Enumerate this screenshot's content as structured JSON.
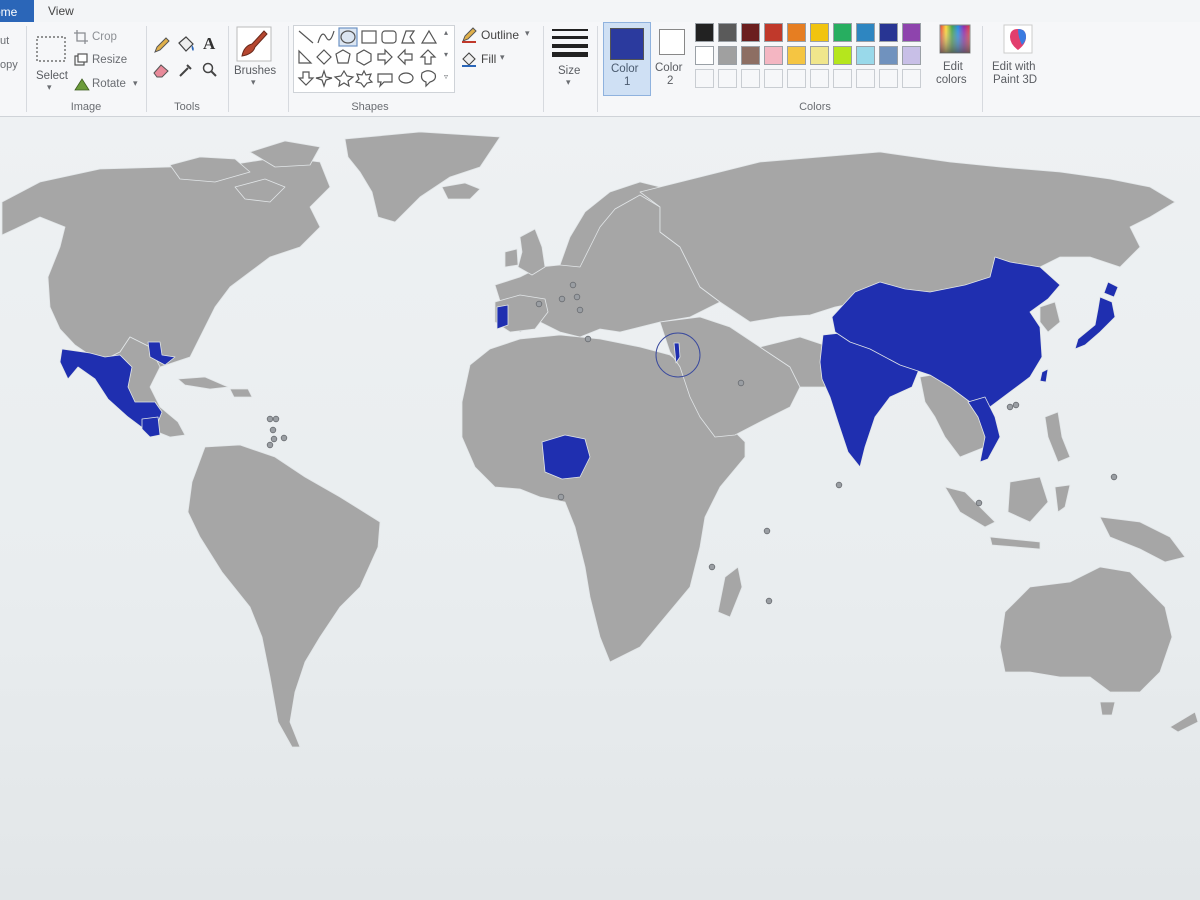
{
  "menu": {
    "home_tab": "ome",
    "view_tab": "View"
  },
  "clipboard": {
    "cut_label": "ut",
    "copy_label": "opy"
  },
  "image_group": {
    "label": "Image",
    "select_label": "Select",
    "crop_label": "Crop",
    "resize_label": "Resize",
    "rotate_label": "Rotate"
  },
  "tools_group": {
    "label": "Tools"
  },
  "brushes_label": "Brushes",
  "shapes_group": {
    "label": "Shapes",
    "outline_label": "Outline",
    "fill_label": "Fill"
  },
  "size_label": "Size",
  "colors_group": {
    "label": "Colors",
    "color1_line1": "Color",
    "color1_line2": "1",
    "color2_line1": "Color",
    "color2_line2": "2",
    "color1_value": "#2b3a9e",
    "color2_value": "#ffffff",
    "edit_colors_line1": "Edit",
    "edit_colors_line2": "colors",
    "paint3d_line1": "Edit with",
    "paint3d_line2": "Paint 3D",
    "palette_row1": [
      "#222222",
      "#5a5a5a",
      "#6b1e1e",
      "#c0392b",
      "#e67e22",
      "#f1c40f",
      "#27ae60",
      "#2e86c1",
      "#283593",
      "#8e44ad"
    ],
    "palette_row2": [
      "#ffffff",
      "#a0a0a0",
      "#8d6e63",
      "#f4b6c2",
      "#f5c542",
      "#f0e68c",
      "#b5e61d",
      "#99d9ea",
      "#7092be",
      "#c8bfe7"
    ]
  },
  "map": {
    "land_color": "#a6a6a6",
    "highlight_color": "#1f2fb0",
    "highlighted_countries": [
      "Mexico",
      "Portugal",
      "Nigeria",
      "India",
      "China",
      "Japan",
      "Vietnam",
      "Guatemala",
      "Israel"
    ]
  }
}
